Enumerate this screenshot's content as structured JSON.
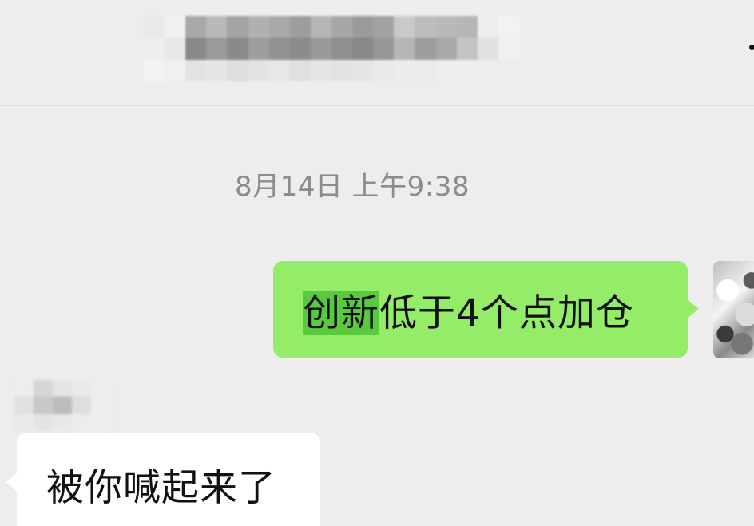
{
  "header": {
    "title_mosaic": [
      [
        "#e9e9e9",
        "#f0f0f0",
        "#a8a8a8",
        "#b9b9b9",
        "#a4a4a4",
        "#b0b0b0",
        "#a9a9a9",
        "#9d9d9d",
        "#b5b5b5",
        "#a7a7a7",
        "#9b9b9b",
        "#a2a2a2",
        "#c9c9c9",
        "#bdbdbd",
        "#b9b9b9",
        "#b6b6b6",
        "#ededed",
        "#f2f2f2"
      ],
      [
        "#eeeeee",
        "#e8e8e8",
        "#888888",
        "#9a9a9a",
        "#8a8a8a",
        "#9e9e9e",
        "#919191",
        "#8c8c8c",
        "#999999",
        "#8f8f8f",
        "#888888",
        "#969696",
        "#b6b6b6",
        "#9e9e9e",
        "#a8a8a8",
        "#c4c4c4",
        "#e1e1e1",
        "#f0f0f0"
      ],
      [
        "#f2f2f2",
        "#f0f0f0",
        "#e3e3e3",
        "#e6e6e6",
        "#dedede",
        "#e3e3e3",
        "#e7e7e7",
        "#e0e0e0",
        "#e6e6e6",
        "#e2e2e2",
        "#e5e5e5",
        "#e9e9e9",
        "#ececec",
        "#ebebeb",
        "#ededed",
        "#ededed",
        "#ededed",
        "#ededed"
      ]
    ]
  },
  "timestamp": "8月14日 上午9:38",
  "messages": {
    "outgoing": {
      "highlighted": "创新",
      "rest": "低于4个点加仓"
    },
    "incoming": {
      "sender_mosaic": [
        [
          "#ededed",
          "#d6d6d6",
          "#e4e4e4",
          "#e9e9e9",
          "#ededed"
        ],
        [
          "#e0e0e0",
          "#c8c8c8",
          "#bcbcbc",
          "#dedede",
          "#ededed"
        ],
        [
          "#e9e9e9",
          "#e4e4e4",
          "#e8e8e8",
          "#ededed",
          "#ededed"
        ]
      ],
      "text": "被你喊起来了"
    }
  },
  "colors": {
    "background": "#ededed",
    "bubble_out": "#95ec69",
    "bubble_in": "#ffffff",
    "highlight": "#59c93e",
    "timestamp": "#8c8c8c"
  }
}
